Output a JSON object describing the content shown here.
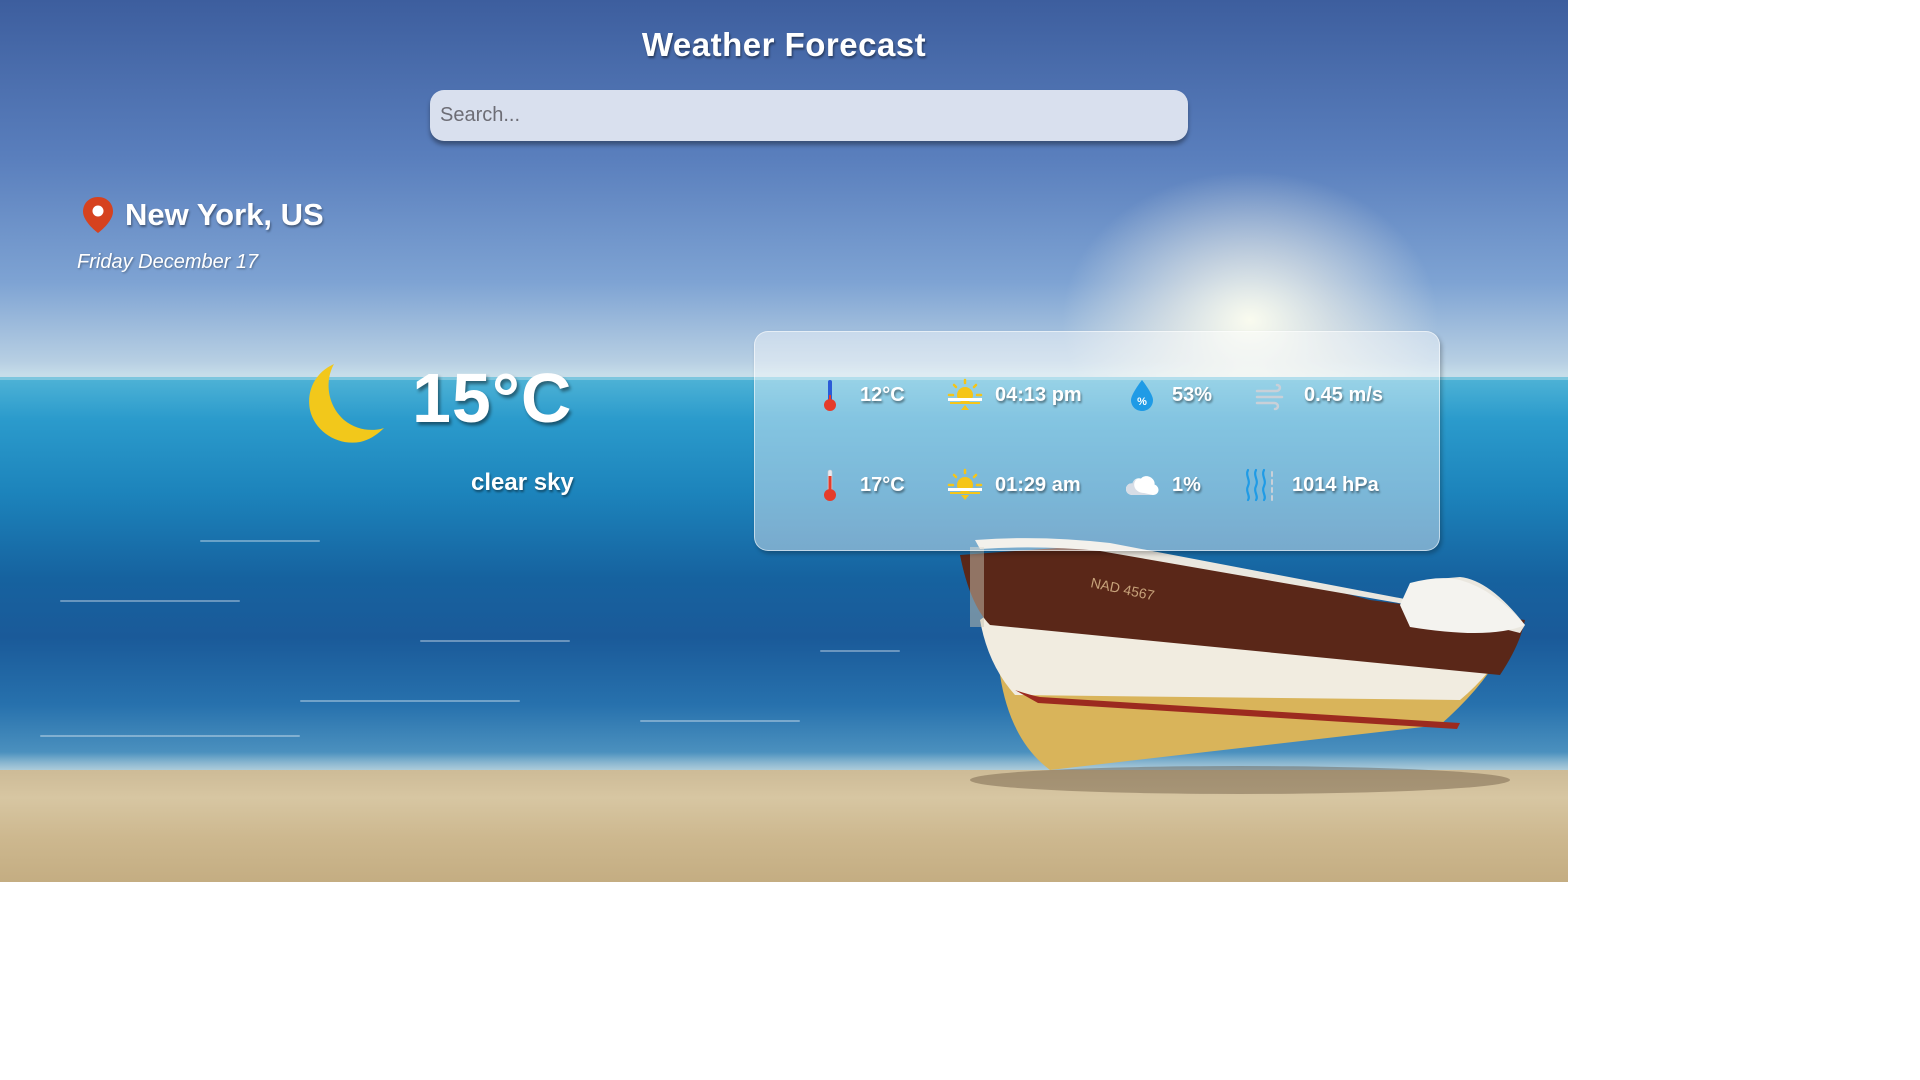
{
  "header": {
    "title": "Weather Forecast"
  },
  "search": {
    "placeholder": "Search...",
    "value": ""
  },
  "location": {
    "city": "New York, US",
    "date": "Friday December 17",
    "icon": "map-pin-icon"
  },
  "current": {
    "temperature": "15°C",
    "description": "clear sky",
    "icon": "moon-icon",
    "icon_color": "#f2c81b"
  },
  "details": {
    "temp_min": "12°C",
    "temp_max": "17°C",
    "sunrise": "04:13 pm",
    "sunset": "01:29 am",
    "humidity": "53%",
    "cloudiness": "1%",
    "wind": "0.45 m/s",
    "pressure": "1014 hPa"
  },
  "colors": {
    "pin": "#d6421f",
    "thermometer_cold": "#2a5bd7",
    "thermometer_hot": "#e53c2b",
    "sun": "#f5c518",
    "drop": "#1f9be6"
  }
}
